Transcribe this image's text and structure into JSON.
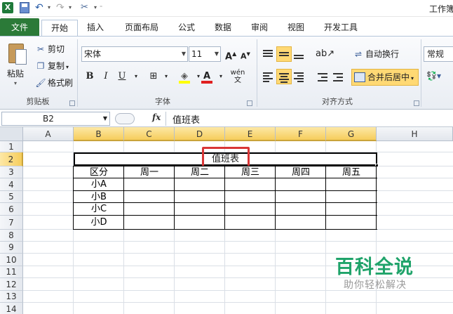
{
  "window": {
    "title": "工作簿"
  },
  "tabs": [
    "文件",
    "开始",
    "插入",
    "页面布局",
    "公式",
    "数据",
    "审阅",
    "视图",
    "开发工具"
  ],
  "active_tab": "开始",
  "ribbon": {
    "clipboard": {
      "paste": "粘贴",
      "cut": "剪切",
      "copy": "复制",
      "format_painter": "格式刷",
      "label": "剪贴板"
    },
    "font": {
      "name": "宋体",
      "size": "11",
      "label": "字体",
      "bold": "B",
      "italic": "I",
      "underline": "U",
      "grow": "A",
      "shrink": "A"
    },
    "alignment": {
      "wrap": "自动换行",
      "merge": "合并后居中",
      "label": "对齐方式"
    },
    "number": {
      "format": "常规"
    }
  },
  "formula_bar": {
    "name_box": "B2",
    "fx": "fx",
    "content": "值班表"
  },
  "columns": [
    "A",
    "B",
    "C",
    "D",
    "E",
    "F",
    "G",
    "H"
  ],
  "selected_column_range": [
    "B",
    "C",
    "D",
    "E",
    "F",
    "G"
  ],
  "rows": [
    "1",
    "2",
    "3",
    "4",
    "5",
    "6",
    "7",
    "8",
    "9",
    "10",
    "11",
    "12",
    "13",
    "14"
  ],
  "selected_row": "2",
  "sheet": {
    "title": "值班表",
    "header": [
      "区分",
      "周一",
      "周二",
      "周三",
      "周四",
      "周五"
    ],
    "names": [
      "小A",
      "小B",
      "小C",
      "小D"
    ]
  },
  "watermark": {
    "main": "百科全说",
    "sub": "助你轻松解决"
  }
}
